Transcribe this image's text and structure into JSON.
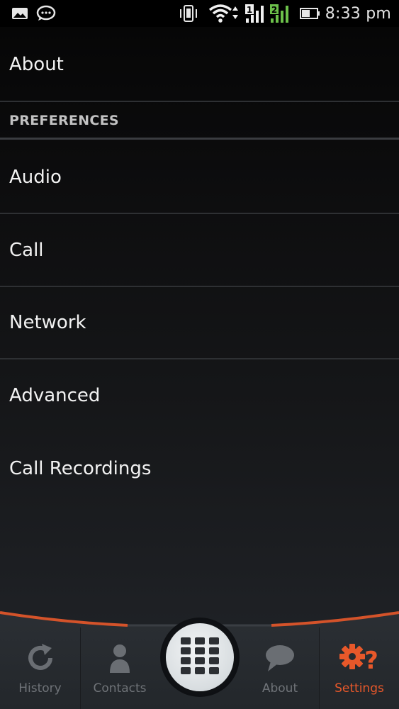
{
  "status_bar": {
    "time": "8:33 pm",
    "sim1_label": "1",
    "sim2_label": "2",
    "icons": [
      "gallery-icon",
      "chat-icon",
      "vibrate-icon",
      "wifi-icon",
      "signal-sim1-icon",
      "signal-sim2-icon",
      "battery-icon"
    ]
  },
  "settings": {
    "about_label": "About",
    "preferences_header": "PREFERENCES",
    "items": [
      {
        "label": "Audio"
      },
      {
        "label": "Call"
      },
      {
        "label": "Network"
      },
      {
        "label": "Advanced"
      },
      {
        "label": "Call Recordings"
      }
    ]
  },
  "bottom_nav": {
    "tabs": [
      {
        "label": "History",
        "icon": "history-icon",
        "active": false
      },
      {
        "label": "Contacts",
        "icon": "contacts-icon",
        "active": false
      },
      {
        "label": "About",
        "icon": "about-icon",
        "active": false
      },
      {
        "label": "Settings",
        "icon": "settings-icon",
        "active": true
      }
    ],
    "dialpad_icon": "dialpad-icon"
  },
  "colors": {
    "accent": "#e8582a",
    "text_primary": "#f2f2f2",
    "text_header": "#c2c2c2",
    "tab_inactive": "#6f7378",
    "sim2_signal": "#6cc04a"
  }
}
